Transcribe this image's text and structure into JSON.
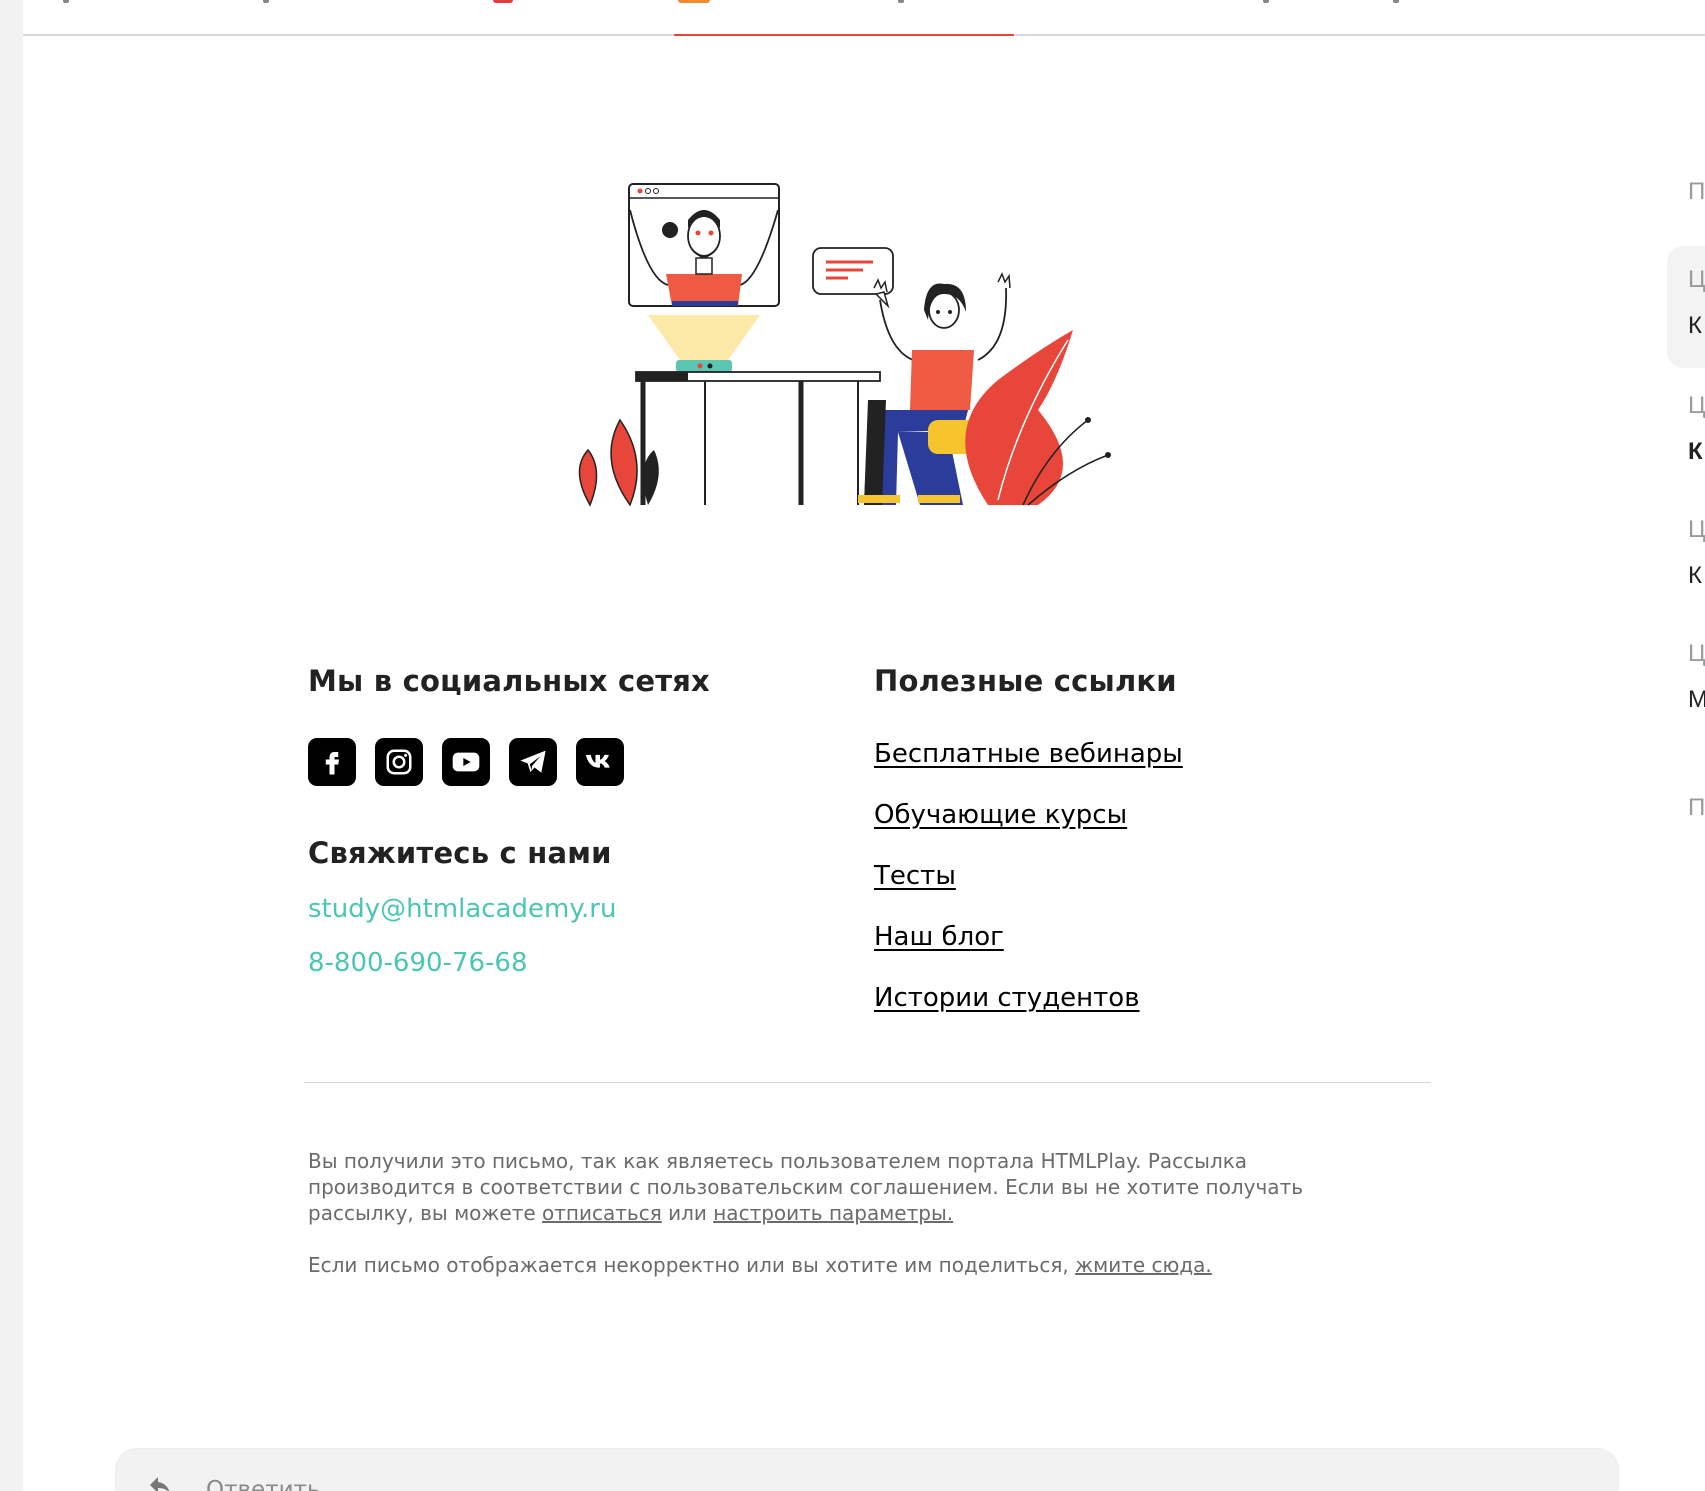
{
  "footer": {
    "social_heading": "Мы в социальных сетях",
    "social_icons": [
      "facebook-icon",
      "instagram-icon",
      "youtube-icon",
      "telegram-icon",
      "vk-icon"
    ],
    "contact_heading": "Свяжитесь с нами",
    "email": "study@htmlacademy.ru",
    "phone": "8-800-690-76-68",
    "links_heading": "Полезные ссылки",
    "links": [
      "Бесплатные вебинары",
      "Обучающие курсы",
      "Тесты",
      "Наш блог",
      "Истории студентов"
    ]
  },
  "legal": {
    "text1": "Вы получили это письмо, так как являетесь пользователем портала HTMLPlay. Рассылка производится в соответствии с пользовательским соглашением. Если вы не хотите получать рассылку, вы можете ",
    "unsubscribe": "отписаться",
    "or": " или ",
    "settings": "настроить параметры.",
    "text2": "Если письмо отображается некорректно или вы хотите им поделиться, ",
    "web_link": "жмите сюда."
  },
  "sidebar_letters": [
    "П",
    "Ц",
    "К",
    "Ц",
    "К",
    "Ц",
    "К",
    "Ц",
    "М",
    "П"
  ],
  "reply": {
    "label": "Ответить"
  },
  "colors": {
    "accent_link": "#4cc6b4",
    "brand_red": "#e8463a"
  }
}
